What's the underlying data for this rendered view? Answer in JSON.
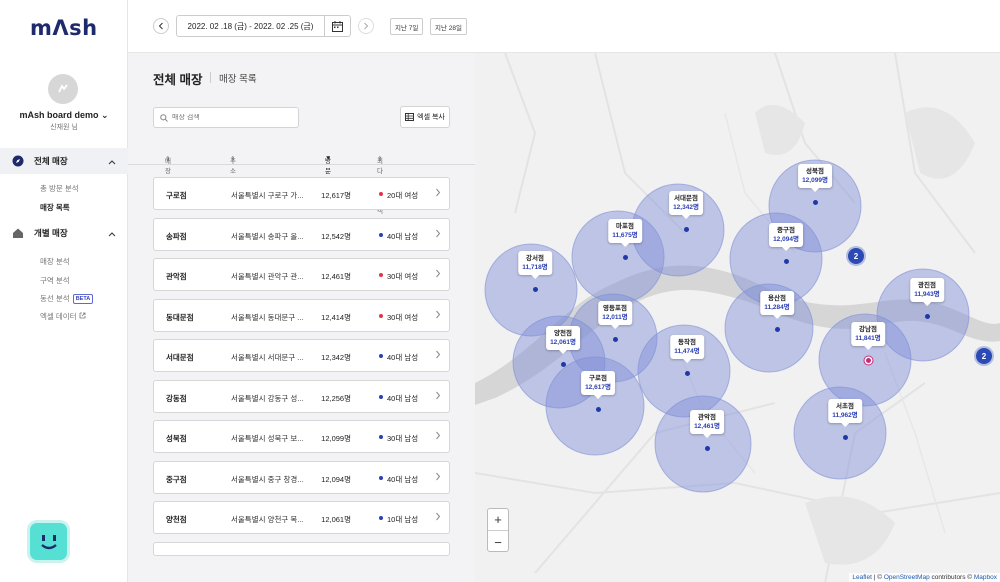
{
  "brand": {
    "logo": "mΛsh"
  },
  "profile": {
    "name": "mAsh board demo",
    "user": "신재원 님"
  },
  "nav": {
    "all_stores": {
      "label": "전체 매장",
      "items": [
        {
          "label": "총 방문 분석"
        },
        {
          "label": "매장 목록"
        }
      ]
    },
    "each_store": {
      "label": "개별 매장",
      "items": [
        {
          "label": "매장 분석"
        },
        {
          "label": "구역 분석"
        },
        {
          "label": "동선 분석",
          "badge": "BETA"
        },
        {
          "label": "엑셀 데이터"
        }
      ]
    }
  },
  "topbar": {
    "date_range": "2022. 02 .18 (금) - 2022. 02 .25 (금)",
    "last7": "지난 7일",
    "last28": "지난 28일"
  },
  "panel": {
    "title": "전체 매장",
    "subtitle": "매장 목록",
    "search_placeholder": "매장 검색",
    "excel_button": "엑셀 복사",
    "columns": {
      "name": "매장 이름",
      "address": "주소",
      "visits": "방문자 수",
      "top_age": "최다 방문 고객군"
    }
  },
  "stores": [
    {
      "name": "구로점",
      "address": "서울특별시 구로구 가...",
      "visits": "12,617명",
      "age": "20대 여성",
      "gender": "female"
    },
    {
      "name": "송파점",
      "address": "서울특별시 송파구 올...",
      "visits": "12,542명",
      "age": "40대 남성",
      "gender": "male"
    },
    {
      "name": "관악점",
      "address": "서울특별시 관악구 관...",
      "visits": "12,461명",
      "age": "30대 여성",
      "gender": "female"
    },
    {
      "name": "동대문점",
      "address": "서울특별시 동대문구 ...",
      "visits": "12,414명",
      "age": "30대 여성",
      "gender": "female"
    },
    {
      "name": "서대문점",
      "address": "서울특별시 서대문구 ...",
      "visits": "12,342명",
      "age": "40대 남성",
      "gender": "male"
    },
    {
      "name": "강동점",
      "address": "서울특별시 강동구 성...",
      "visits": "12,256명",
      "age": "40대 남성",
      "gender": "male"
    },
    {
      "name": "성북점",
      "address": "서울특별시 성북구 보...",
      "visits": "12,099명",
      "age": "30대 남성",
      "gender": "male"
    },
    {
      "name": "중구점",
      "address": "서울특별시 중구 창경...",
      "visits": "12,094명",
      "age": "40대 남성",
      "gender": "male"
    },
    {
      "name": "양천점",
      "address": "서울특별시 양천구 목...",
      "visits": "12,061명",
      "age": "10대 남성",
      "gender": "male"
    }
  ],
  "map_markers": [
    {
      "name": "성북점",
      "value": "12,099명"
    },
    {
      "name": "서대문점",
      "value": "12,342명"
    },
    {
      "name": "마포점",
      "value": "11,675명"
    },
    {
      "name": "중구점",
      "value": "12,094명"
    },
    {
      "name": "강서점",
      "value": "11,718명"
    },
    {
      "name": "광진점",
      "value": "11,943명"
    },
    {
      "name": "용산점",
      "value": "11,284명"
    },
    {
      "name": "영등포점",
      "value": "12,011명"
    },
    {
      "name": "양천점",
      "value": "12,061명"
    },
    {
      "name": "강남점",
      "value": "11,841명"
    },
    {
      "name": "동작점",
      "value": "11,474명"
    },
    {
      "name": "구로점",
      "value": "12,617명"
    },
    {
      "name": "서초점",
      "value": "11,962명"
    },
    {
      "name": "관악점",
      "value": "12,461명"
    }
  ],
  "clusters": [
    {
      "count": "2"
    },
    {
      "count": "2"
    }
  ],
  "map_attribution": {
    "leaflet": "Leaflet",
    "sep": " | © ",
    "osm": "OpenStreetMap",
    "mid": " contributors © ",
    "mapbox": "Mapbox"
  },
  "colors": {
    "male": "#2c3fb3",
    "female": "#e0344a",
    "brand": "#1d2a6b",
    "circle": "#7f8fd6"
  }
}
